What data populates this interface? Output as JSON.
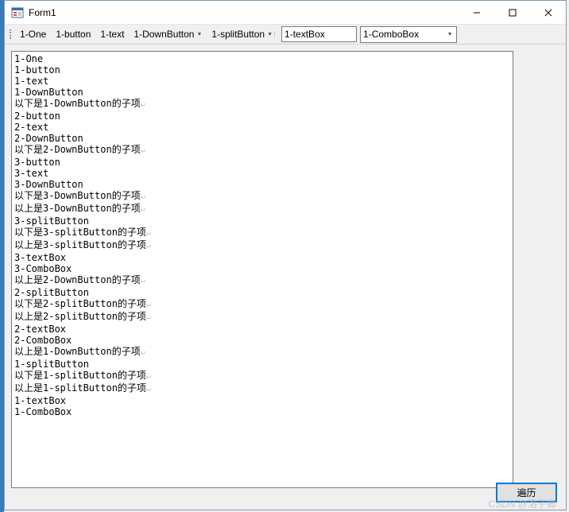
{
  "window": {
    "title": "Form1"
  },
  "toolstrip": {
    "one": "1-One",
    "button": "1-button",
    "text": "1-text",
    "downbutton": "1-DownButton",
    "splitbutton": "1-splitButton",
    "textbox_value": "1-textBox",
    "combobox_value": "1-ComboBox"
  },
  "richtext_lines": [
    "1-One",
    "1-button",
    "1-text",
    "1-DownButton",
    "",
    "以下是1-DownButton的子项",
    "2-button",
    "2-text",
    "2-DownButton",
    "",
    "以下是2-DownButton的子项",
    "3-button",
    "3-text",
    "3-DownButton",
    "",
    "以下是3-DownButton的子项",
    "以上是3-DownButton的子项",
    "",
    "3-splitButton",
    "",
    "以下是3-splitButton的子项",
    "以上是3-splitButton的子项",
    "",
    "3-textBox",
    "3-ComboBox",
    "以上是2-DownButton的子项",
    "",
    "2-splitButton",
    "",
    "以下是2-splitButton的子项",
    "以上是2-splitButton的子项",
    "",
    "2-textBox",
    "2-ComboBox",
    "以上是1-DownButton的子项",
    "",
    "1-splitButton",
    "",
    "以下是1-splitButton的子项",
    "以上是1-splitButton的子项",
    "",
    "1-textBox",
    "1-ComboBox"
  ],
  "button": {
    "traverse": "遍历"
  },
  "watermark": "CSDN @洛子卿"
}
